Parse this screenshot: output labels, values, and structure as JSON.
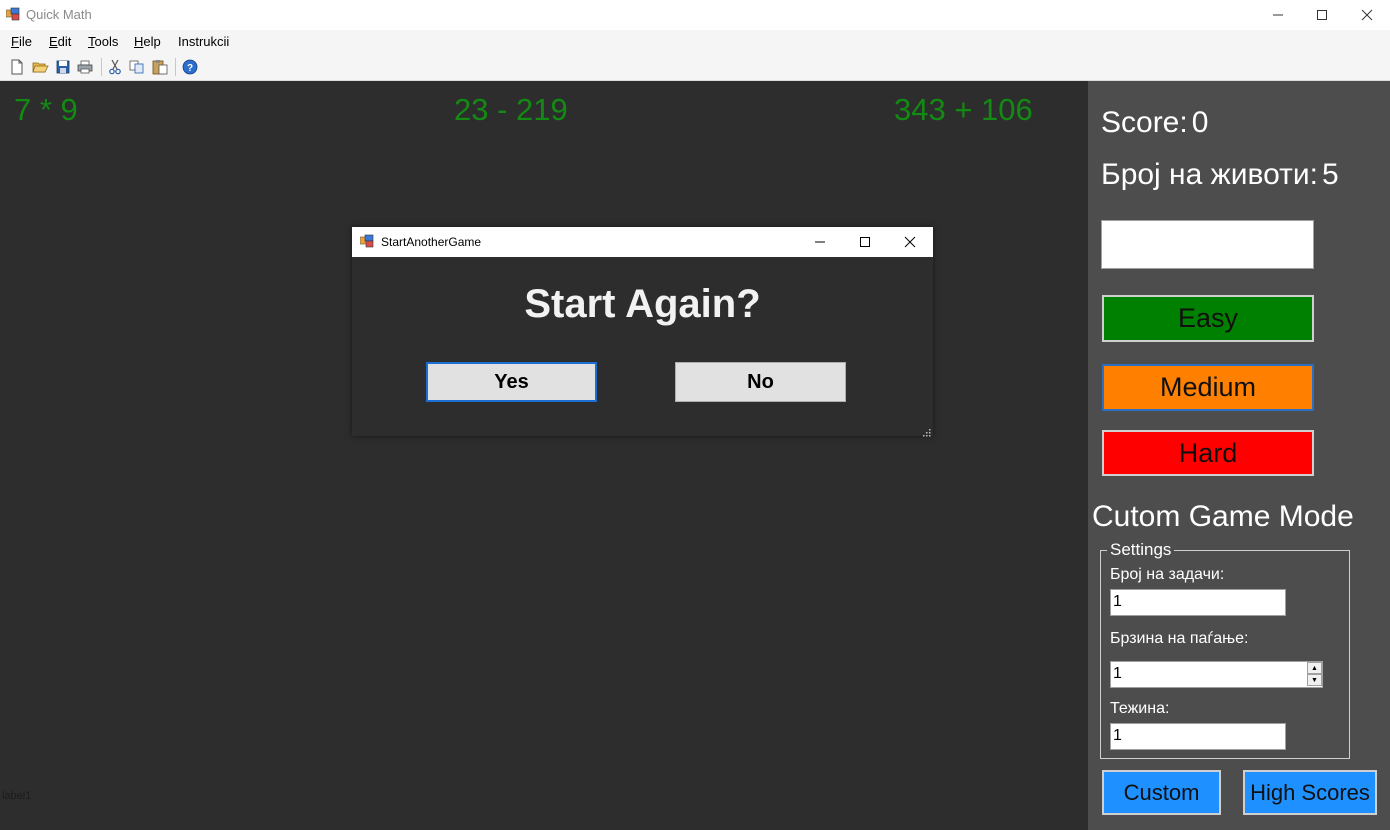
{
  "window": {
    "title": "Quick Math"
  },
  "menu": [
    {
      "pre": "",
      "accel": "F",
      "rest": "ile"
    },
    {
      "pre": "",
      "accel": "E",
      "rest": "dit"
    },
    {
      "pre": "",
      "accel": "T",
      "rest": "ools"
    },
    {
      "pre": "",
      "accel": "H",
      "rest": "elp"
    },
    {
      "pre": "Instrukcii",
      "accel": "",
      "rest": ""
    }
  ],
  "toolbar": {
    "icons": [
      "new-file-icon",
      "open-folder-icon",
      "save-icon",
      "print-icon",
      "cut-icon",
      "copy-icon",
      "paste-icon",
      "help-icon"
    ]
  },
  "game": {
    "problems": [
      "7 * 9",
      "23 - 219",
      "343 + 106"
    ],
    "label1": "label1",
    "problem_color": "#138a13"
  },
  "stats": {
    "score_label": "Score:",
    "score_value": "0",
    "lives_label": "Број на животи:",
    "lives_value": "5"
  },
  "answer_input": {
    "value": ""
  },
  "difficulty": {
    "easy": "Easy",
    "medium": "Medium",
    "hard": "Hard",
    "colors": {
      "easy": "#008000",
      "medium": "#ff8000",
      "hard": "#ff0000"
    }
  },
  "custom": {
    "title": "Cutom Game Mode",
    "settings_legend": "Settings",
    "tasks_label": "Број на задачи:",
    "tasks_value": "1",
    "speed_label": "Брзина на паѓање:",
    "speed_value": "1",
    "difficulty_label": "Тежина:",
    "difficulty_value": "1"
  },
  "buttons": {
    "custom": "Custom",
    "high_scores": "High Scores"
  },
  "dialog": {
    "title": "StartAnotherGame",
    "heading": "Start Again?",
    "yes": "Yes",
    "no": "No"
  }
}
